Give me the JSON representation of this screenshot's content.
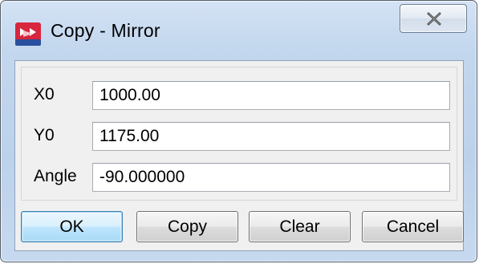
{
  "window": {
    "title": "Copy - Mirror",
    "icon": "app-logo-icon",
    "close_icon": "close-icon"
  },
  "fields": [
    {
      "label": "X0",
      "value": "1000.00"
    },
    {
      "label": "Y0",
      "value": "1175.00"
    },
    {
      "label": "Angle",
      "value": "-90.000000"
    }
  ],
  "buttons": {
    "ok": "OK",
    "copy": "Copy",
    "clear": "Clear",
    "cancel": "Cancel"
  },
  "colors": {
    "titlebar": "#c3d7ee",
    "client": "#f0f0f0",
    "default_button_border": "#3c7fb1",
    "icon_red": "#d7263d"
  }
}
